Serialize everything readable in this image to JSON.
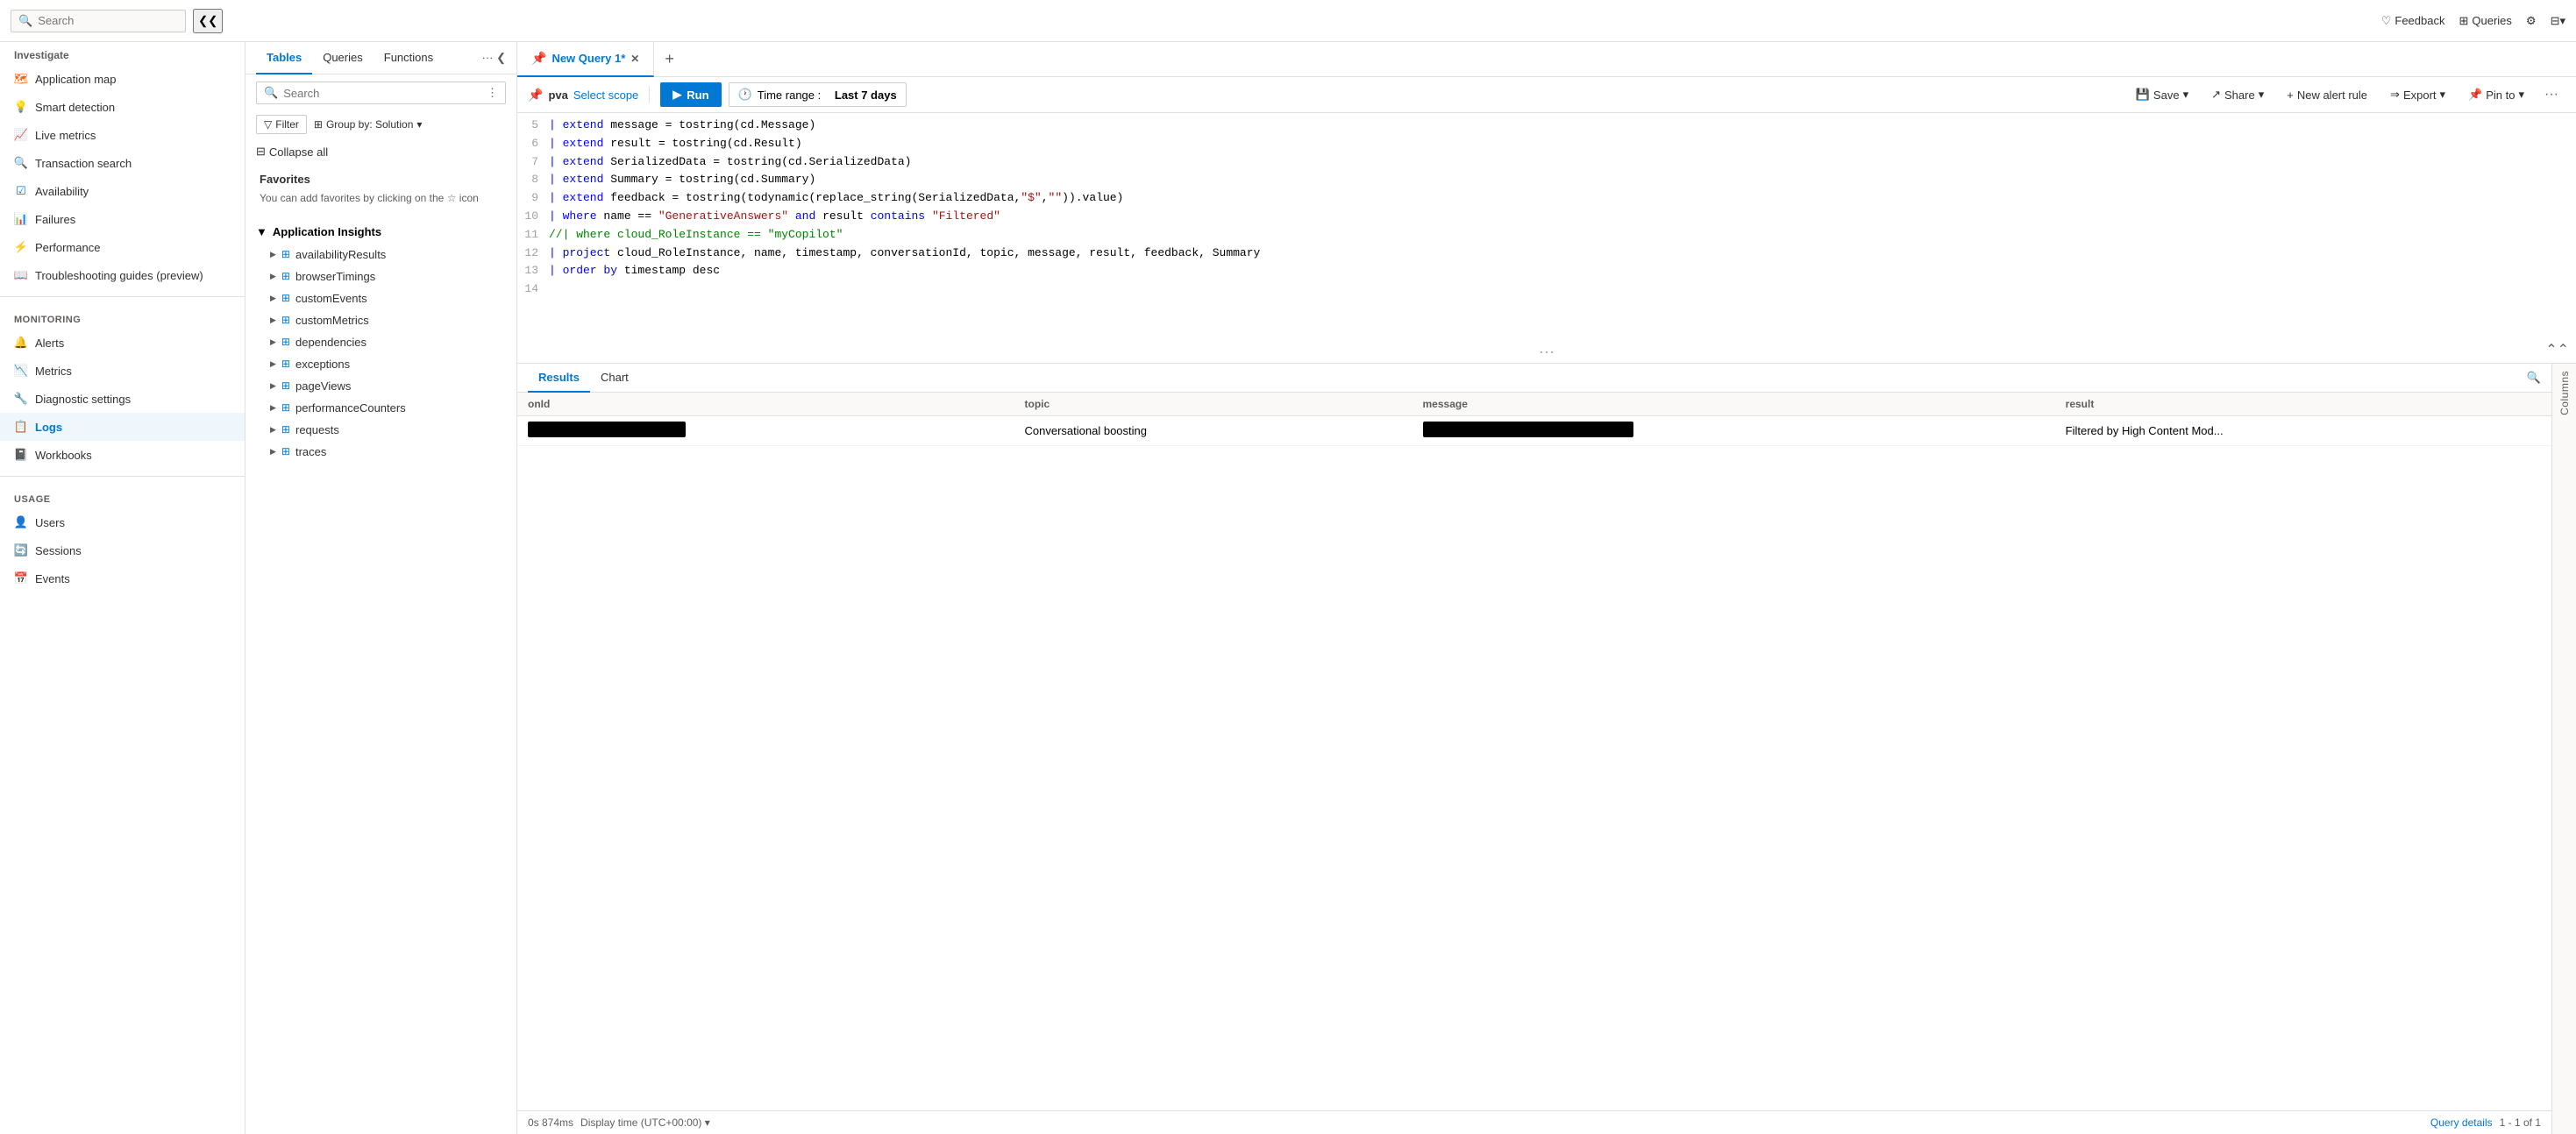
{
  "topbar": {
    "search_placeholder": "Search",
    "feedback_label": "Feedback",
    "queries_label": "Queries"
  },
  "sidebar": {
    "investigate_label": "Investigate",
    "items_investigate": [
      {
        "id": "application-map",
        "label": "Application map",
        "icon": "map"
      },
      {
        "id": "smart-detection",
        "label": "Smart detection",
        "icon": "smart"
      },
      {
        "id": "live-metrics",
        "label": "Live metrics",
        "icon": "live"
      },
      {
        "id": "transaction-search",
        "label": "Transaction search",
        "icon": "search"
      },
      {
        "id": "availability",
        "label": "Availability",
        "icon": "availability"
      },
      {
        "id": "failures",
        "label": "Failures",
        "icon": "failures"
      },
      {
        "id": "performance",
        "label": "Performance",
        "icon": "performance"
      },
      {
        "id": "troubleshooting",
        "label": "Troubleshooting guides (preview)",
        "icon": "guide"
      }
    ],
    "monitoring_label": "Monitoring",
    "items_monitoring": [
      {
        "id": "alerts",
        "label": "Alerts",
        "icon": "alert"
      },
      {
        "id": "metrics",
        "label": "Metrics",
        "icon": "metrics"
      },
      {
        "id": "diagnostic-settings",
        "label": "Diagnostic settings",
        "icon": "settings"
      },
      {
        "id": "logs",
        "label": "Logs",
        "icon": "logs",
        "active": true
      },
      {
        "id": "workbooks",
        "label": "Workbooks",
        "icon": "workbooks"
      }
    ],
    "usage_label": "Usage",
    "items_usage": [
      {
        "id": "users",
        "label": "Users",
        "icon": "users"
      },
      {
        "id": "sessions",
        "label": "Sessions",
        "icon": "sessions"
      },
      {
        "id": "events",
        "label": "Events",
        "icon": "events"
      }
    ]
  },
  "middle": {
    "tabs": [
      {
        "id": "tables",
        "label": "Tables",
        "active": true
      },
      {
        "id": "queries",
        "label": "Queries"
      },
      {
        "id": "functions",
        "label": "Functions"
      }
    ],
    "search_placeholder": "Search",
    "filter_label": "Filter",
    "groupby_label": "Group by: Solution",
    "collapse_all_label": "Collapse all",
    "favorites_title": "Favorites",
    "favorites_hint": "You can add favorites by clicking on the ☆ icon",
    "app_insights_label": "Application Insights",
    "tables": [
      "availabilityResults",
      "browserTimings",
      "customEvents",
      "customMetrics",
      "dependencies",
      "exceptions",
      "pageViews",
      "performanceCounters",
      "requests",
      "traces"
    ]
  },
  "query": {
    "tab_label": "New Query 1*",
    "new_tab_icon": "+",
    "scope_name": "pva",
    "select_scope_label": "Select scope",
    "run_label": "Run",
    "time_range_label": "Time range :",
    "time_range_value": "Last 7 days",
    "save_label": "Save",
    "share_label": "Share",
    "new_alert_label": "New alert rule",
    "export_label": "Export",
    "pin_to_label": "Pin to",
    "more_label": "···",
    "lines": [
      {
        "num": 5,
        "tokens": [
          {
            "t": "kw",
            "v": "| extend "
          },
          {
            "t": "norm",
            "v": "message = tostring(cd.Message)"
          }
        ]
      },
      {
        "num": 6,
        "tokens": [
          {
            "t": "kw",
            "v": "| extend "
          },
          {
            "t": "norm",
            "v": "result = tostring(cd.Result)"
          }
        ]
      },
      {
        "num": 7,
        "tokens": [
          {
            "t": "kw",
            "v": "| extend "
          },
          {
            "t": "norm",
            "v": "SerializedData = tostring(cd.SerializedData)"
          }
        ]
      },
      {
        "num": 8,
        "tokens": [
          {
            "t": "kw",
            "v": "| extend "
          },
          {
            "t": "norm",
            "v": "Summary = tostring(cd.Summary)"
          }
        ]
      },
      {
        "num": 9,
        "tokens": [
          {
            "t": "kw",
            "v": "| extend "
          },
          {
            "t": "norm",
            "v": "feedback = tostring(todynamic(replace_string(SerializedData,"
          },
          {
            "t": "str",
            "v": "\"$\""
          },
          {
            "t": "norm",
            "v": ","
          },
          {
            "t": "str",
            "v": "\"\""
          },
          {
            "t": "norm",
            "v": ")).value)"
          }
        ]
      },
      {
        "num": 10,
        "tokens": [
          {
            "t": "kw",
            "v": "| where "
          },
          {
            "t": "norm",
            "v": "name == "
          },
          {
            "t": "str",
            "v": "\"GenerativeAnswers\""
          },
          {
            "t": "norm",
            "v": " "
          },
          {
            "t": "kw",
            "v": "and"
          },
          {
            "t": "norm",
            "v": " result "
          },
          {
            "t": "kw",
            "v": "contains"
          },
          {
            "t": "norm",
            "v": " "
          },
          {
            "t": "str",
            "v": "\"Filtered\""
          }
        ]
      },
      {
        "num": 11,
        "tokens": [
          {
            "t": "comment",
            "v": "//| where cloud_RoleInstance == \"myCopilot\""
          }
        ]
      },
      {
        "num": 12,
        "tokens": [
          {
            "t": "kw",
            "v": "| project "
          },
          {
            "t": "norm",
            "v": "cloud_RoleInstance, name, timestamp, conversationId, topic, message, result, feedback, Summary"
          }
        ]
      },
      {
        "num": 13,
        "tokens": [
          {
            "t": "kw",
            "v": "| order by "
          },
          {
            "t": "norm",
            "v": "timestamp desc"
          }
        ]
      },
      {
        "num": 14,
        "tokens": [
          {
            "t": "norm",
            "v": ""
          }
        ]
      }
    ]
  },
  "results": {
    "tabs": [
      {
        "id": "results",
        "label": "Results",
        "active": true
      },
      {
        "id": "chart",
        "label": "Chart"
      }
    ],
    "columns": [
      "onId",
      "topic",
      "message",
      "result"
    ],
    "rows": [
      {
        "onId": "",
        "topic": "Conversational boosting",
        "message": "",
        "result": "Filtered by High Content Mod..."
      }
    ],
    "columns_sidebar_label": "Columns"
  },
  "statusbar": {
    "time": "0s 874ms",
    "display_time": "Display time (UTC+00:00)",
    "query_details_label": "Query details",
    "record_count": "1 - 1 of 1"
  }
}
